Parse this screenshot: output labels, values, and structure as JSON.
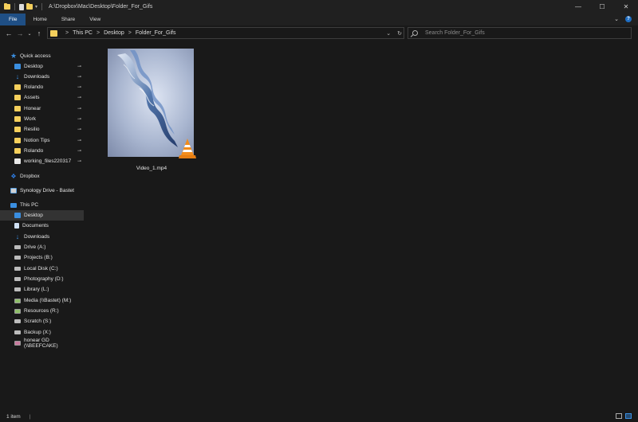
{
  "window": {
    "title": "A:\\Dropbox\\Mac\\Desktop\\Folder_For_Gifs",
    "controls": {
      "minimize": "—",
      "maximize": "☐",
      "close": "✕"
    }
  },
  "quick_access_toolbar": {
    "dropdown": "▾"
  },
  "ribbon": {
    "tabs": [
      "File",
      "Home",
      "Share",
      "View"
    ],
    "expand": "⌄",
    "help": "?"
  },
  "navigation": {
    "back": "←",
    "forward": "→",
    "recent": "⌄",
    "up": "↑",
    "breadcrumbs": [
      "This PC",
      "Desktop",
      "Folder_For_Gifs"
    ],
    "separator": ">",
    "dropdown": "⌄",
    "refresh": "↻"
  },
  "search": {
    "placeholder": "Search Folder_For_Gifs"
  },
  "sidebar": {
    "quick_access": {
      "label": "Quick access",
      "icon": "star-icon"
    },
    "pinned": [
      {
        "label": "Desktop",
        "icon": "desktop-icon"
      },
      {
        "label": "Downloads",
        "icon": "download-icon"
      },
      {
        "label": "Rolando",
        "icon": "folder-icon"
      },
      {
        "label": "Assets",
        "icon": "folder-icon"
      },
      {
        "label": "Honear",
        "icon": "folder-icon"
      },
      {
        "label": "Work",
        "icon": "folder-icon"
      },
      {
        "label": "Resilio",
        "icon": "folder-icon"
      },
      {
        "label": "Notion Tips",
        "icon": "folder-icon"
      },
      {
        "label": "Rolando",
        "icon": "folder-icon"
      },
      {
        "label": "working_files220317",
        "icon": "folder-icon"
      }
    ],
    "pin_glyph": "📌",
    "dropbox": "Dropbox",
    "synology": "Synology Drive - Bastet",
    "this_pc": "This PC",
    "pc_items": [
      {
        "label": "Desktop",
        "icon": "desktop-icon",
        "selected": true
      },
      {
        "label": "Documents",
        "icon": "documents-icon"
      },
      {
        "label": "Downloads",
        "icon": "download-icon"
      },
      {
        "label": "Drive (A:)",
        "icon": "drive-icon"
      },
      {
        "label": "Projects (B:)",
        "icon": "drive-icon"
      },
      {
        "label": "Local Disk (C:)",
        "icon": "drive-icon"
      },
      {
        "label": "Photography (D:)",
        "icon": "drive-icon"
      },
      {
        "label": "Library (L:)",
        "icon": "drive-icon"
      },
      {
        "label": "Media (\\\\Bastet) (M:)",
        "icon": "network-drive-icon"
      },
      {
        "label": "Resources (R:)",
        "icon": "network-drive-icon"
      },
      {
        "label": "Scratch (S:)",
        "icon": "drive-icon"
      },
      {
        "label": "Backup (X:)",
        "icon": "drive-icon"
      },
      {
        "label": "honear GD (\\\\BEEFCAKE)",
        "icon": "network-drive-icon"
      }
    ]
  },
  "files": [
    {
      "name": "Video_1.mp4",
      "icon": "vlc-icon"
    }
  ],
  "status": {
    "count": "1 item",
    "separator": "|"
  },
  "colors": {
    "accent": "#1f4f85",
    "folder": "#f4cf5c",
    "background": "#191919",
    "selected": "#333333"
  }
}
